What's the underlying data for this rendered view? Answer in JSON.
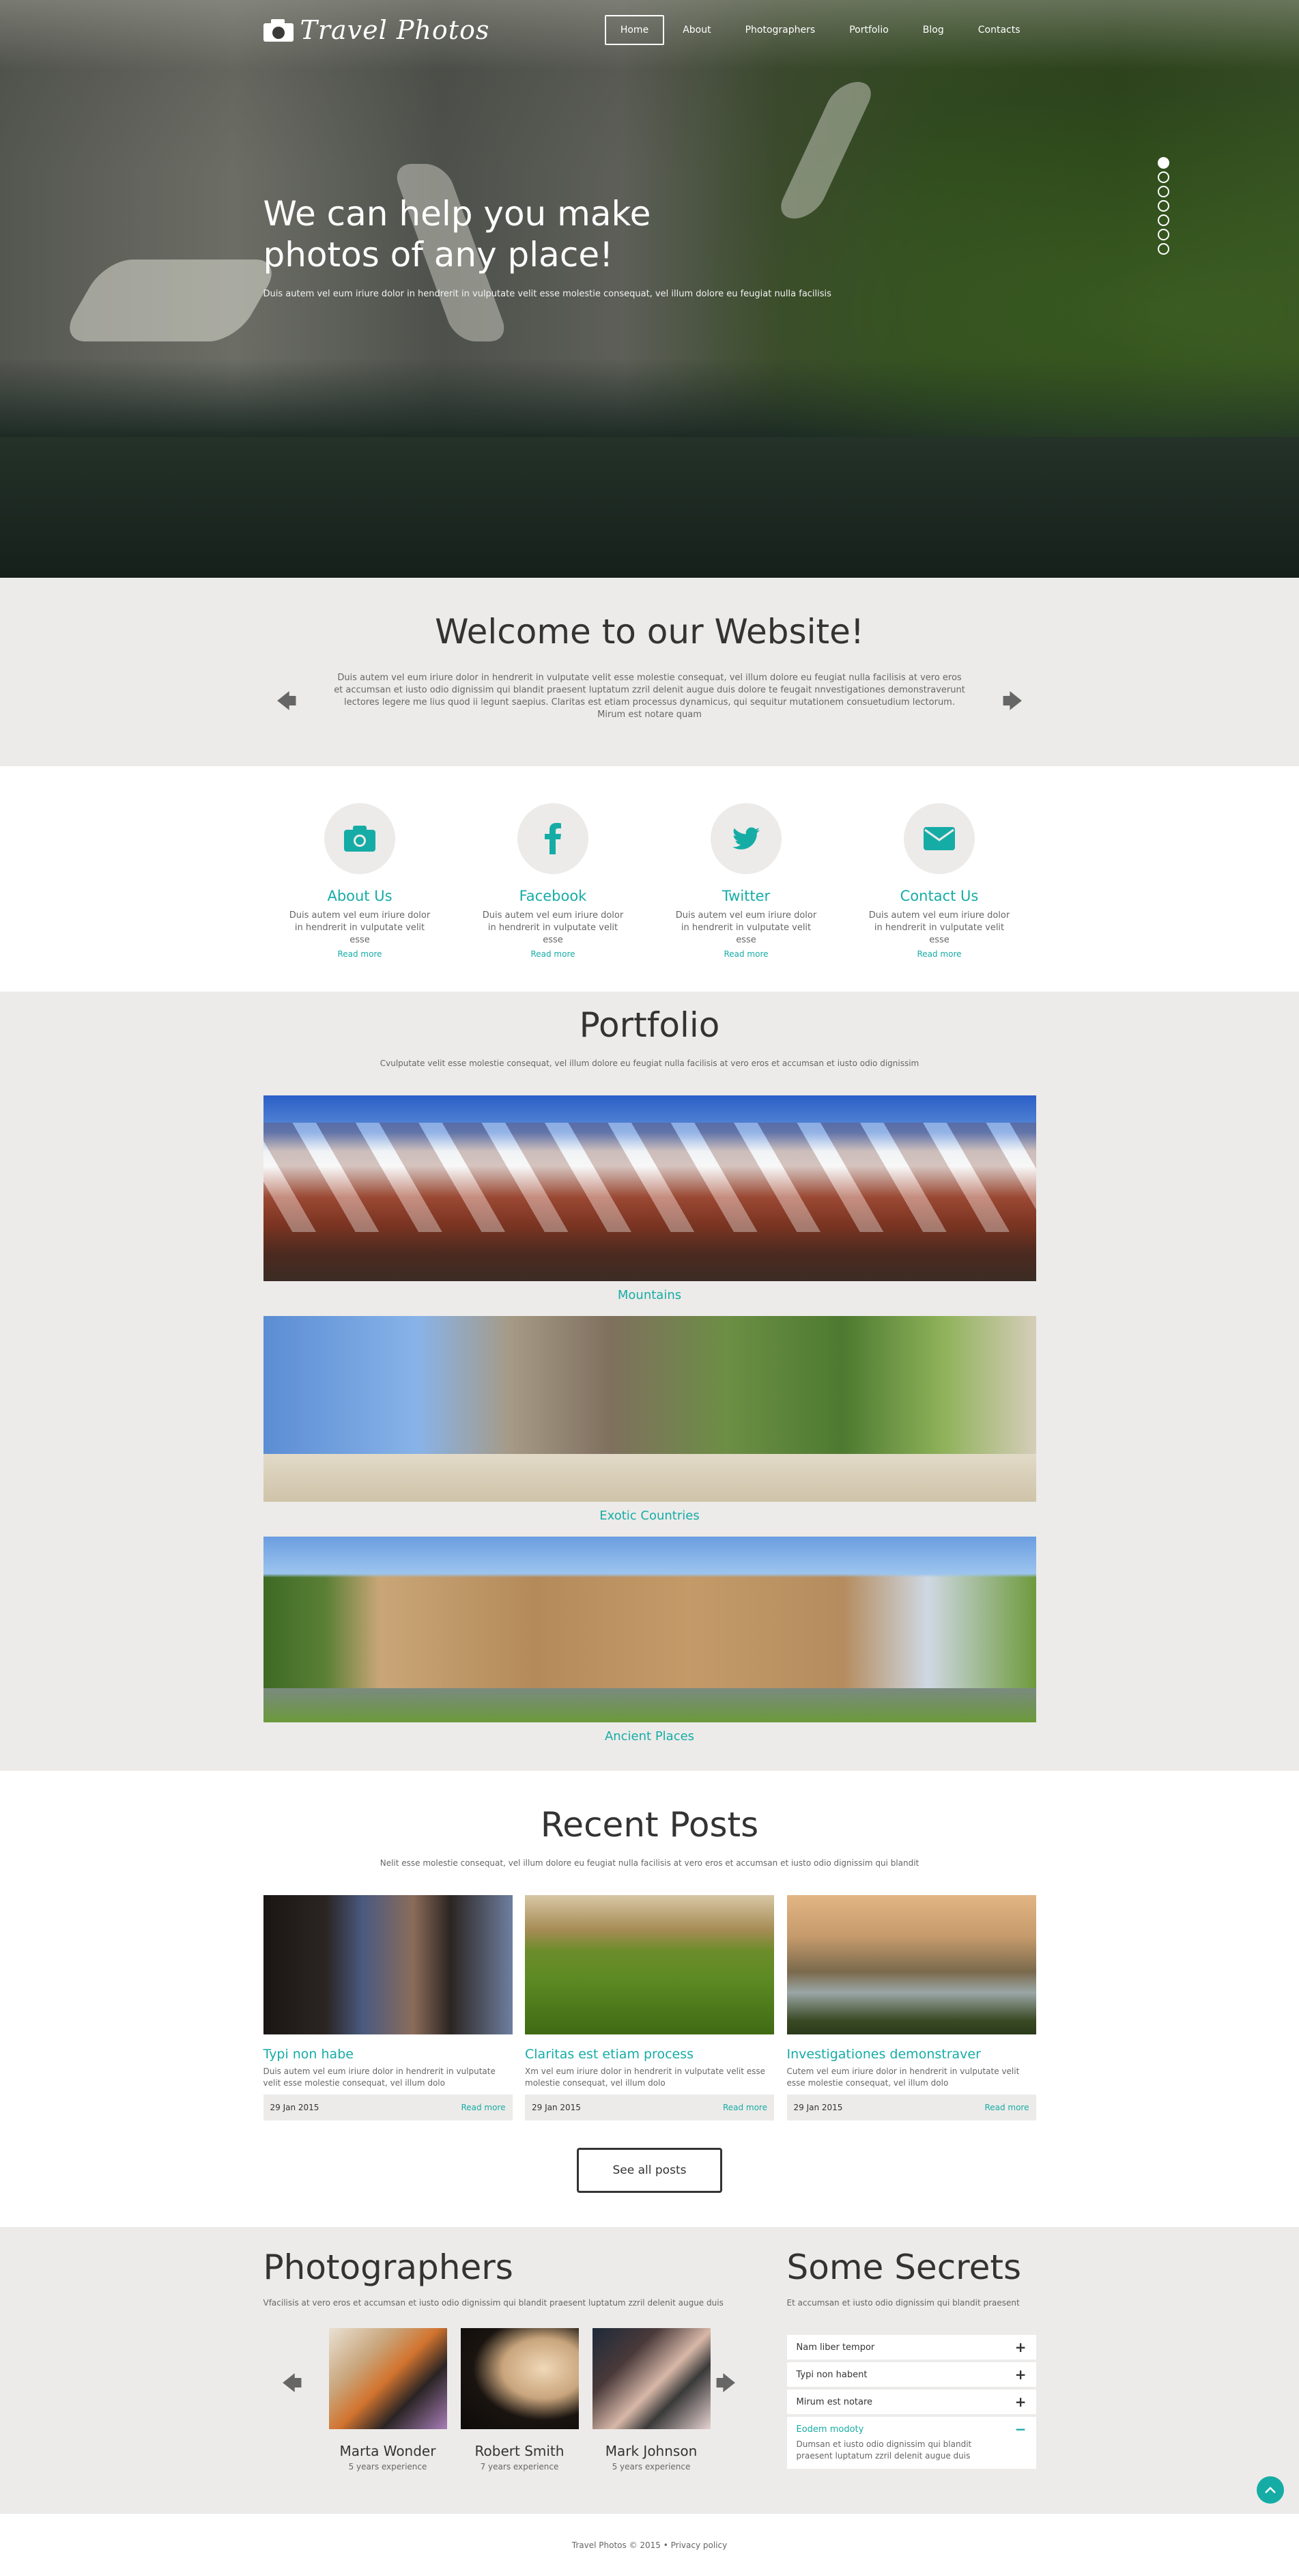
{
  "brand": {
    "name": "Travel Photos",
    "logo_icon": "camera-icon"
  },
  "nav": {
    "items": [
      {
        "label": "Home",
        "active": true
      },
      {
        "label": "About",
        "active": false
      },
      {
        "label": "Photographers",
        "active": false
      },
      {
        "label": "Portfolio",
        "active": false
      },
      {
        "label": "Blog",
        "active": false
      },
      {
        "label": "Contacts",
        "active": false
      }
    ]
  },
  "hero": {
    "title": "We can help you make photos of any place!",
    "text": "Duis autem vel eum iriure dolor in hendrerit in vulputate velit esse molestie consequat, vel illum dolore eu feugiat nulla facilisis",
    "slides_count": 7,
    "active_slide": 1
  },
  "welcome": {
    "title": "Welcome to our Website!",
    "text": "Duis autem vel eum iriure dolor in hendrerit in vulputate velit esse molestie consequat, vel illum dolore eu feugiat nulla facilisis at vero eros et accumsan et iusto odio dignissim qui blandit praesent luptatum zzril delenit augue duis dolore te feugait nnvestigationes demonstraverunt lectores legere me lius quod ii legunt saepius. Claritas est etiam processus dynamicus, qui sequitur mutationem consuetudium lectorum. Mirum est notare quam",
    "prev_icon": "arrow-left-icon",
    "next_icon": "arrow-right-icon"
  },
  "features": [
    {
      "icon": "camera-icon",
      "title": "About Us",
      "text": "Duis autem vel eum iriure dolor in hendrerit in vulputate velit esse",
      "link": "Read more"
    },
    {
      "icon": "facebook-icon",
      "title": "Facebook",
      "text": "Duis autem vel eum iriure dolor in hendrerit in vulputate velit esse",
      "link": "Read more"
    },
    {
      "icon": "twitter-icon",
      "title": "Twitter",
      "text": "Duis autem vel eum iriure dolor in hendrerit in vulputate velit esse",
      "link": "Read more"
    },
    {
      "icon": "envelope-icon",
      "title": "Contact Us",
      "text": "Duis autem vel eum iriure dolor in hendrerit in vulputate velit esse",
      "link": "Read more"
    }
  ],
  "portfolio": {
    "title": "Portfolio",
    "subtitle": "Cvulputate velit esse molestie consequat, vel illum dolore eu feugiat nulla facilisis at vero eros et accumsan et iusto odio dignissim",
    "items": [
      {
        "label": "Mountains"
      },
      {
        "label": "Exotic Countries"
      },
      {
        "label": "Ancient Places"
      }
    ]
  },
  "posts": {
    "title": "Recent Posts",
    "subtitle": "Nelit esse molestie consequat, vel illum dolore eu feugiat nulla facilisis at vero eros et accumsan et iusto odio dignissim qui blandit",
    "items": [
      {
        "title": "Typi non habe",
        "text": "Duis autem vel eum iriure dolor in hendrerit in vulputate velit esse molestie consequat, vel illum dolo",
        "date": "29 Jan 2015",
        "link": "Read more"
      },
      {
        "title": "Claritas est etiam process",
        "text": "Xm vel eum iriure dolor in hendrerit in vulputate velit esse molestie consequat, vel illum dolo",
        "date": "29 Jan 2015",
        "link": "Read more"
      },
      {
        "title": "Investigationes demonstraver",
        "text": "Cutem vel eum iriure dolor in hendrerit in vulputate velit esse molestie consequat, vel illum dolo",
        "date": "29 Jan 2015",
        "link": "Read more"
      }
    ],
    "see_all": "See all posts"
  },
  "photographers": {
    "title": "Photographers",
    "subtitle": "Vfacilisis at vero eros et accumsan et iusto odio dignissim qui blandit praesent luptatum zzril delenit augue duis",
    "items": [
      {
        "name": "Marta Wonder",
        "experience": "5 years experience"
      },
      {
        "name": "Robert Smith",
        "experience": "7 years experience"
      },
      {
        "name": "Mark Johnson",
        "experience": "5 years experience"
      }
    ]
  },
  "secrets": {
    "title": "Some Secrets",
    "subtitle": "Et accumsan et iusto odio dignissim qui blandit praesent",
    "items": [
      {
        "title": "Nam liber tempor",
        "toggle": "+",
        "open": false
      },
      {
        "title": "Typi non habent",
        "toggle": "+",
        "open": false
      },
      {
        "title": "Mirum est notare",
        "toggle": "+",
        "open": false
      },
      {
        "title": "Eodem modoty",
        "toggle": "−",
        "open": true,
        "body": "Dumsan et iusto odio dignissim qui blandit praesent luptatum zzril delenit augue duis"
      }
    ]
  },
  "footer": {
    "text": "Travel Photos © 2015 • Privacy policy"
  },
  "colors": {
    "accent": "#16aca6",
    "section_bg": "#ecebe9",
    "text_dark": "#333333",
    "text_muted": "#666666"
  }
}
